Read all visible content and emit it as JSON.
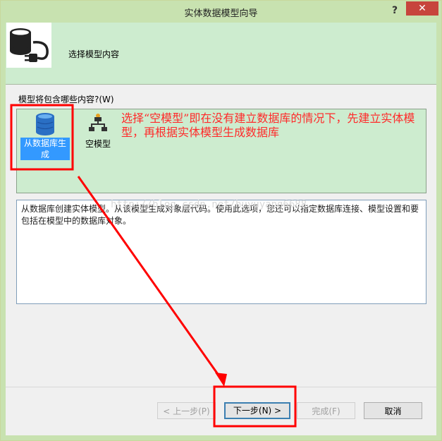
{
  "window": {
    "title": "实体数据模型向导",
    "help_glyph": "?",
    "close_glyph": "✕"
  },
  "header": {
    "title": "选择模型内容",
    "icon": "database-plug-icon"
  },
  "question_label": "模型将包含哪些内容?(W)",
  "model_options": [
    {
      "label": "从数据库生成",
      "icon": "database-icon",
      "selected": true
    },
    {
      "label": "空模型",
      "icon": "empty-model-icon",
      "selected": false
    }
  ],
  "annotation": "选择“空模型”即在没有建立数据库的情况下，先建立实体模型，再根据实体模型生成数据库",
  "description": "从数据库创建实体模型。从该模型生成对象层代码。使用此选项，您还可以指定数据库连接、模型设置和要包括在模型中的数据库对象。",
  "watermark": "http://blog.csdn.net/huyuyang6688",
  "buttons": {
    "prev": "< 上一步(P)",
    "next": "下一步(N) >",
    "finish": "完成(F)",
    "cancel": "取消"
  },
  "colors": {
    "title_bar": "#c8e2b0",
    "header_bg": "#cdeccf",
    "selection": "#3399ff",
    "annotation_red": "#ff2a2a",
    "close_button": "#c7443c"
  }
}
